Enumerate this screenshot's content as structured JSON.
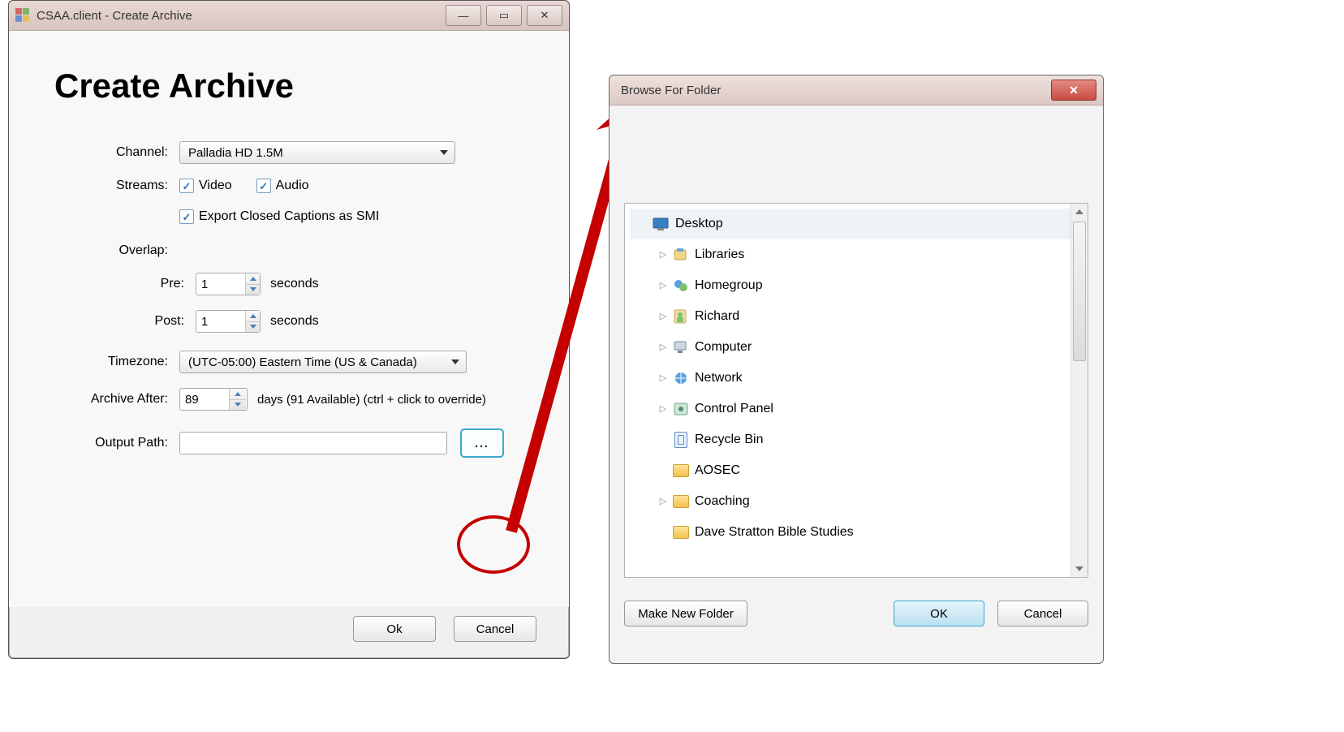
{
  "win1": {
    "title": "CSAA.client - Create Archive",
    "heading": "Create Archive",
    "labels": {
      "channel": "Channel:",
      "streams": "Streams:",
      "overlap": "Overlap:",
      "pre": "Pre:",
      "post": "Post:",
      "timezone": "Timezone:",
      "archiveAfter": "Archive After:",
      "outputPath": "Output Path:"
    },
    "channelValue": "Palladia HD 1.5M",
    "videoLabel": "Video",
    "audioLabel": "Audio",
    "ccLabel": "Export Closed Captions as SMI",
    "preValue": "1",
    "postValue": "1",
    "secondsLabel": "seconds",
    "timezoneValue": "(UTC-05:00) Eastern Time (US & Canada)",
    "archiveAfterValue": "89",
    "archiveAfterSuffix": "days (91 Available) (ctrl + click to override)",
    "outputPathValue": "",
    "browseLabel": "...",
    "ok": "Ok",
    "cancel": "Cancel"
  },
  "win2": {
    "title": "Browse For Folder",
    "nodes": [
      {
        "label": "Desktop",
        "icon": "desktop",
        "indent": 0,
        "exp": "",
        "sel": true
      },
      {
        "label": "Libraries",
        "icon": "lib",
        "indent": 1,
        "exp": "▷"
      },
      {
        "label": "Homegroup",
        "icon": "home",
        "indent": 1,
        "exp": "▷"
      },
      {
        "label": "Richard",
        "icon": "user",
        "indent": 1,
        "exp": "▷"
      },
      {
        "label": "Computer",
        "icon": "comp",
        "indent": 1,
        "exp": "▷"
      },
      {
        "label": "Network",
        "icon": "net",
        "indent": 1,
        "exp": "▷"
      },
      {
        "label": "Control Panel",
        "icon": "cpl",
        "indent": 1,
        "exp": "▷"
      },
      {
        "label": "Recycle Bin",
        "icon": "recycle",
        "indent": 1,
        "exp": ""
      },
      {
        "label": "AOSEC",
        "icon": "folder",
        "indent": 1,
        "exp": ""
      },
      {
        "label": "Coaching",
        "icon": "folder",
        "indent": 1,
        "exp": "▷"
      },
      {
        "label": "Dave Stratton Bible Studies",
        "icon": "folder",
        "indent": 1,
        "exp": ""
      }
    ],
    "makeNew": "Make New Folder",
    "ok": "OK",
    "cancel": "Cancel"
  }
}
